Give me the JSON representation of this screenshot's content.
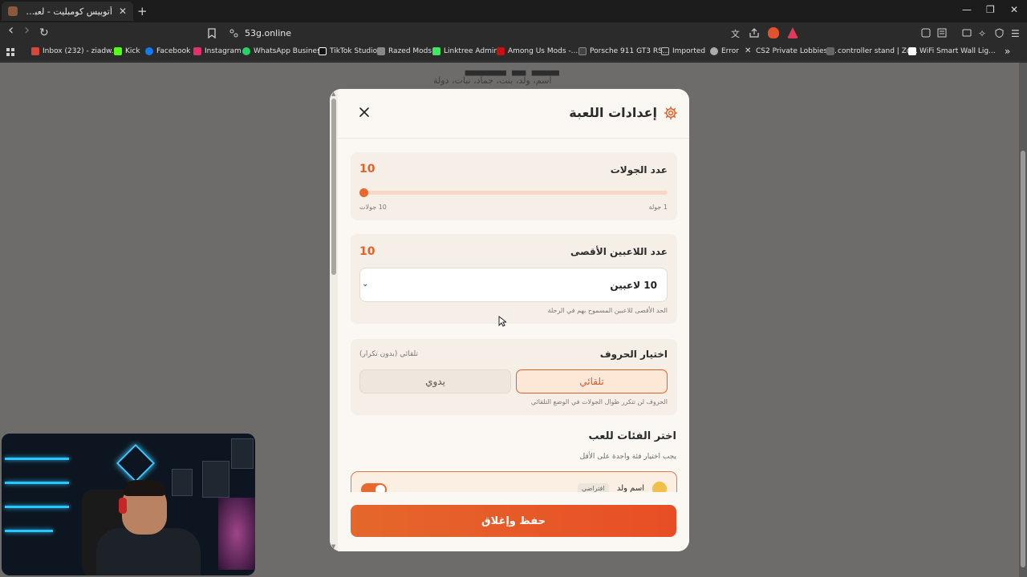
{
  "browser": {
    "tab_title": "أتوبيس كومبليت - لعبة الأسماء",
    "tab_close": "✕",
    "new_tab": "+",
    "url": "53g.online",
    "window_controls": {
      "minimize": "—",
      "restore": "❐",
      "close": "✕"
    },
    "nav": {
      "back": "‹",
      "forward": "›",
      "reload": "↻"
    },
    "bookmarks": [
      {
        "label": "Inbox (232) - ziadw...",
        "color": "#d9453a"
      },
      {
        "label": "Kick",
        "color": "#53fc18"
      },
      {
        "label": "Facebook",
        "color": "#1877f2"
      },
      {
        "label": "Instagram",
        "color": "#e1306c"
      },
      {
        "label": "WhatsApp Business",
        "color": "#25d366"
      },
      {
        "label": "TikTok Studio",
        "color": "#ffffff"
      },
      {
        "label": "Razed Mods",
        "color": "#888888"
      },
      {
        "label": "Linktree Admin",
        "color": "#43e660"
      },
      {
        "label": "Among Us Mods -...",
        "color": "#c51111"
      },
      {
        "label": "Porsche 911 GT3 RS...",
        "color": "#444444"
      },
      {
        "label": "Imported",
        "color": "#bbbbbb"
      },
      {
        "label": "Error",
        "color": "#aaaaaa"
      },
      {
        "label": "CS2 Private Lobbies:...",
        "color": "#dddddd"
      },
      {
        "label": "controller stand | Zo...",
        "color": "#666666"
      },
      {
        "label": "WiFi Smart Wall Lig...",
        "color": "#ffffff"
      }
    ],
    "bookmarks_overflow": "»"
  },
  "page_background": {
    "subtitle": "اسم، ولد، بنت، جماد، نبات، دولة"
  },
  "modal": {
    "title": "إعدادات اللعبة",
    "close_icon": "close-icon",
    "rounds": {
      "label": "عدد الجولات",
      "value": "10",
      "min_label": "1 جولة",
      "max_label": "10 جولات",
      "slider_fraction": 0.0
    },
    "players": {
      "label": "عدد اللاعبين الأقصى",
      "value": "10",
      "selected": "10 لاعبين",
      "hint": "الحد الأقصى للاعبين المسموح بهم في الرحلة"
    },
    "letters": {
      "label": "اختيار الحروف",
      "mode_note": "تلقائي (بدون تكرار)",
      "options": [
        {
          "label": "تلقائي",
          "active": true
        },
        {
          "label": "يدوي",
          "active": false
        }
      ],
      "hint": "الحروف لن تتكرر طوال الجولات في الوضع التلقائي"
    },
    "categories": {
      "title": "اختر الفئات للعب",
      "subtitle": "يجب اختيار فئة واحدة على الأقل",
      "items": [
        {
          "name": "اسم ولد",
          "badge": "افتراضي",
          "enabled": true
        }
      ]
    },
    "save_button": "حفظ وإغلاق"
  },
  "colors": {
    "accent": "#e0622a",
    "modal_bg": "#fbf8f3",
    "card_bg": "#f5efe7"
  }
}
